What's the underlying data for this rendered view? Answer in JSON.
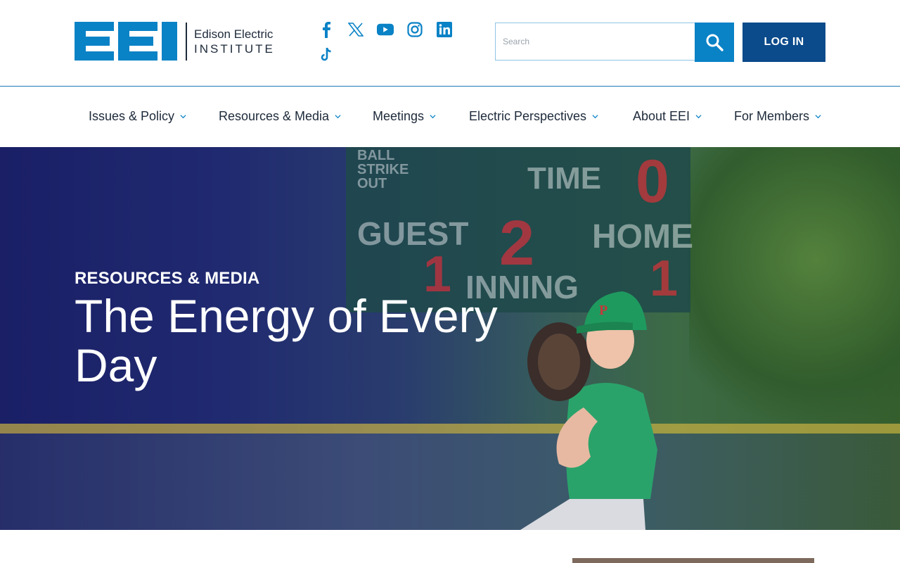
{
  "brand": {
    "mark": "EEI",
    "name_line1": "Edison Electric",
    "name_line2": "INSTITUTE",
    "color": "#0a82c6"
  },
  "social": [
    "facebook-icon",
    "x-icon",
    "youtube-icon",
    "instagram-icon",
    "linkedin-icon",
    "tiktok-icon"
  ],
  "search": {
    "placeholder": "Search"
  },
  "header": {
    "login_label": "LOG IN"
  },
  "nav": {
    "items": [
      "Issues & Policy",
      "Resources & Media",
      "Meetings",
      "Electric Perspectives",
      "About EEI",
      "For Members"
    ]
  },
  "hero": {
    "eyebrow": "RESOURCES & MEDIA",
    "title": "The Energy of Every Day",
    "scoreboard": {
      "ball_strike_out": "BALL STRIKE OUT",
      "time": "TIME",
      "time_value": "0",
      "guest": "GUEST",
      "guest_value": "1",
      "inning_value": "2",
      "inning": "INNING",
      "home": "HOME",
      "home_value": "1"
    }
  },
  "colors": {
    "primary": "#0a82c6",
    "login": "#0b4a8b",
    "text": "#1d2a3a"
  }
}
